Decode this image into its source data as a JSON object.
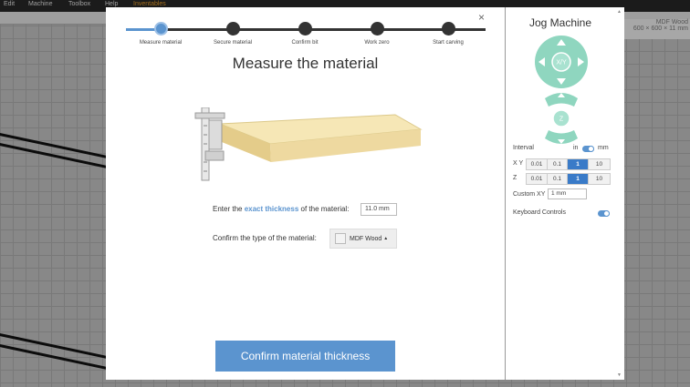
{
  "background": {
    "menu": [
      "Edit",
      "Machine",
      "Toolbox",
      "Help",
      "Inventables"
    ],
    "material_title": "MDF Wood",
    "material_size": "600 × 600 × 11 mm"
  },
  "modal": {
    "close_icon": "×",
    "steps": [
      {
        "label": "Measure material",
        "active": true
      },
      {
        "label": "Secure material",
        "active": false
      },
      {
        "label": "Confirm bit",
        "active": false
      },
      {
        "label": "Work zero",
        "active": false
      },
      {
        "label": "Start carving",
        "active": false
      }
    ],
    "title": "Measure the material",
    "thickness_prefix": "Enter the ",
    "thickness_highlight": "exact thickness",
    "thickness_suffix": " of the material:",
    "thickness_value": "11.0 mm",
    "material_label": "Confirm the type of the material:",
    "material_value": "MDF Wood",
    "confirm_label": "Confirm material thickness"
  },
  "jog": {
    "title": "Jog Machine",
    "xy_center": "X/Y",
    "z_center": "Z",
    "interval_label": "Interval",
    "unit_in": "in",
    "unit_mm": "mm",
    "xy_label": "X Y",
    "z_label": "Z",
    "xy_options": [
      "0.01",
      "0.1",
      "1",
      "10"
    ],
    "z_options": [
      "0.01",
      "0.1",
      "1",
      "10"
    ],
    "selected": "1",
    "custom_xy_label": "Custom XY",
    "custom_xy_value": "1 mm",
    "keyboard_label": "Keyboard Controls",
    "keyboard_enabled": true,
    "accent": "#5b94cf",
    "jog_color": "#8fd6bf"
  }
}
